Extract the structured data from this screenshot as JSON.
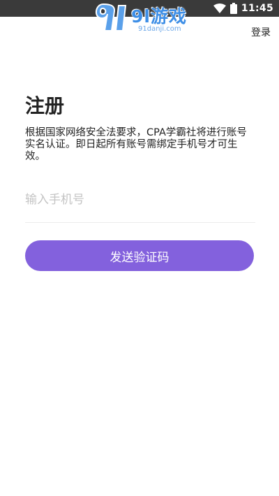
{
  "status_bar": {
    "time": "11:45",
    "icons": [
      "wifi-icon",
      "battery-icon"
    ]
  },
  "watermark": {
    "logo_text": "9l游戏",
    "site": "91danji.com"
  },
  "header": {
    "login_label": "登录"
  },
  "register": {
    "title": "注册",
    "notice": "根据国家网络安全法要求，CPA学霸社将进行账号实名认证。即日起所有账号需绑定手机号才可生效。",
    "phone_placeholder": "输入手机号",
    "phone_value": "",
    "send_code_label": "发送验证码"
  },
  "colors": {
    "accent": "#8361dd",
    "status_bar": "#3a3a3a",
    "placeholder": "#c4c4c4",
    "watermark": "#3d8ee6"
  }
}
